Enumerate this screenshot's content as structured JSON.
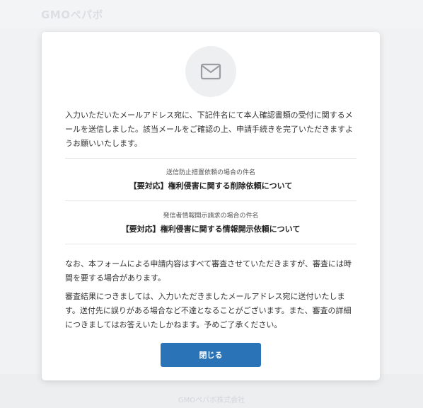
{
  "background": {
    "brand": "GMOペパボ",
    "footer": "GMOペパボ株式会社"
  },
  "modal": {
    "icon": "mail-icon",
    "intro": "入力いただいたメールアドレス宛に、下記件名にて本人確認書類の受付に関するメールを送信しました。該当メールをご確認の上、申請手続きを完了いただきますようお願いいたします。",
    "subjects": [
      {
        "label": "送信防止措置依頼の場合の件名",
        "title": "【要対応】権利侵害に関する削除依頼について"
      },
      {
        "label": "発信者情報開示請求の場合の件名",
        "title": "【要対応】権利侵害に関する情報開示依頼について"
      }
    ],
    "note1": "なお、本フォームによる申請内容はすべて審査させていただきますが、審査には時間を要する場合があります。",
    "note2": "審査結果につきましては、入力いただきましたメールアドレス宛に送付いたします。送付先に誤りがある場合など不達となることがございます。また、審査の詳細につきましてはお答えいたしかねます。予めご了承ください。",
    "close_label": "閉じる"
  },
  "colors": {
    "primary": "#2b73b7",
    "background": "#f1f2f3",
    "icon_circle": "#eeeff1"
  }
}
